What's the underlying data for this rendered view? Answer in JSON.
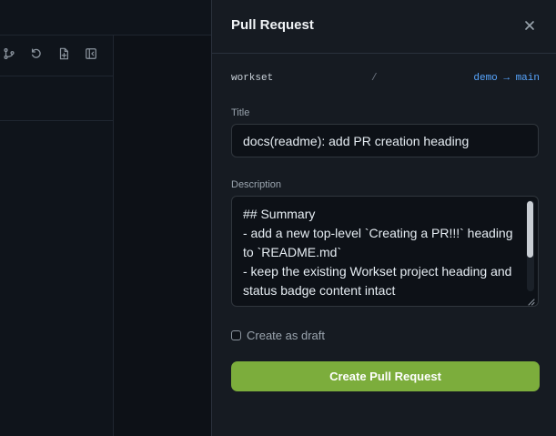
{
  "drawer": {
    "title": "Pull Request",
    "repo": "workset",
    "separator": "/",
    "branches": "demo → main",
    "title_label": "Title",
    "title_value": "docs(readme): add PR creation heading",
    "description_label": "Description",
    "description_value": "## Summary\n- add a new top-level `Creating a PR!!!` heading to `README.md`\n- keep the existing Workset project heading and status badge content intact",
    "draft_label": "Create as draft",
    "submit_label": "Create Pull Request"
  },
  "toolbar": {
    "icons": [
      "branch-icon",
      "refresh-icon",
      "new-file-icon",
      "collapse-panel-icon"
    ]
  },
  "colors": {
    "accent_blue": "#58a6ff",
    "submit_green": "#7cad3c",
    "background": "#0d1117",
    "drawer_bg": "#161b22"
  }
}
